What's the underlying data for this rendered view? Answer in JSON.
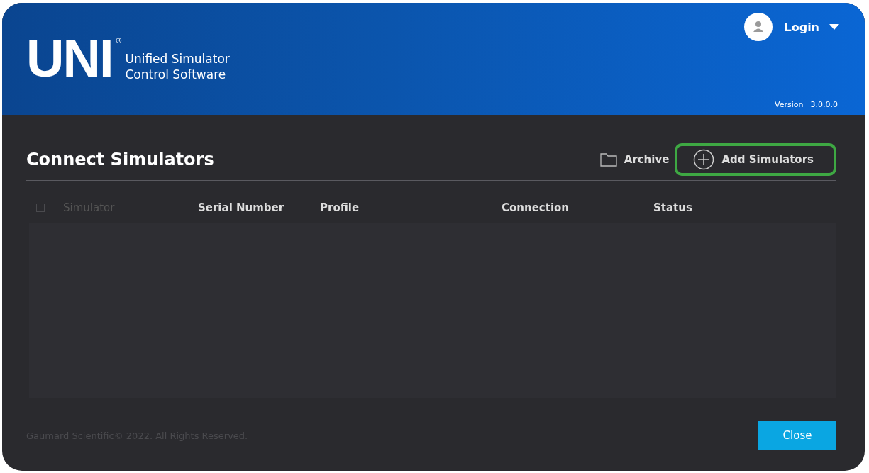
{
  "header": {
    "logo": "UNI",
    "logo_mark": "®",
    "product_name": [
      "Unified Simulator",
      "Control Software"
    ],
    "user": {
      "label": "Login"
    },
    "version_label": "Version",
    "version": "3.0.0.0"
  },
  "page": {
    "title": "Connect Simulators",
    "actions": [
      {
        "kind": "archive",
        "label": "Archive",
        "highlighted": false
      },
      {
        "kind": "add",
        "label": "Add Simulators",
        "highlighted": true
      }
    ]
  },
  "table": {
    "select_all": {
      "checked": false
    },
    "columns": [
      {
        "label": "Simulator",
        "disabled": true
      },
      {
        "label": "Serial Number",
        "disabled": false
      },
      {
        "label": "Profile",
        "disabled": false
      },
      {
        "label": "Connection",
        "disabled": false
      },
      {
        "label": "Status",
        "disabled": false
      }
    ]
  },
  "footer": {
    "copyright": "Gaumard Scientific© 2022. All Rights Reserved.",
    "close_button": "Close"
  }
}
